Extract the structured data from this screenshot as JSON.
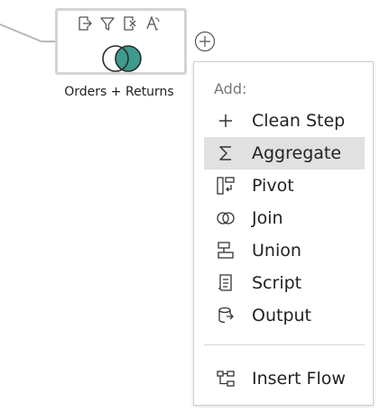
{
  "canvas": {
    "node": {
      "label": "Orders + Returns",
      "tools": [
        "keep-only-icon",
        "filter-icon",
        "exclude-icon",
        "rename-icon"
      ],
      "venn_color": "#3d9a8c"
    },
    "add_button_icon": "plus-circle-icon"
  },
  "menu": {
    "heading": "Add:",
    "items": [
      {
        "label": "Clean Step",
        "icon": "plus-icon",
        "selected": false
      },
      {
        "label": "Aggregate",
        "icon": "sigma-icon",
        "selected": true
      },
      {
        "label": "Pivot",
        "icon": "pivot-icon",
        "selected": false
      },
      {
        "label": "Join",
        "icon": "join-icon",
        "selected": false
      },
      {
        "label": "Union",
        "icon": "union-icon",
        "selected": false
      },
      {
        "label": "Script",
        "icon": "script-icon",
        "selected": false
      },
      {
        "label": "Output",
        "icon": "output-icon",
        "selected": false
      }
    ],
    "footer_item": {
      "label": "Insert Flow",
      "icon": "insert-flow-icon"
    }
  }
}
